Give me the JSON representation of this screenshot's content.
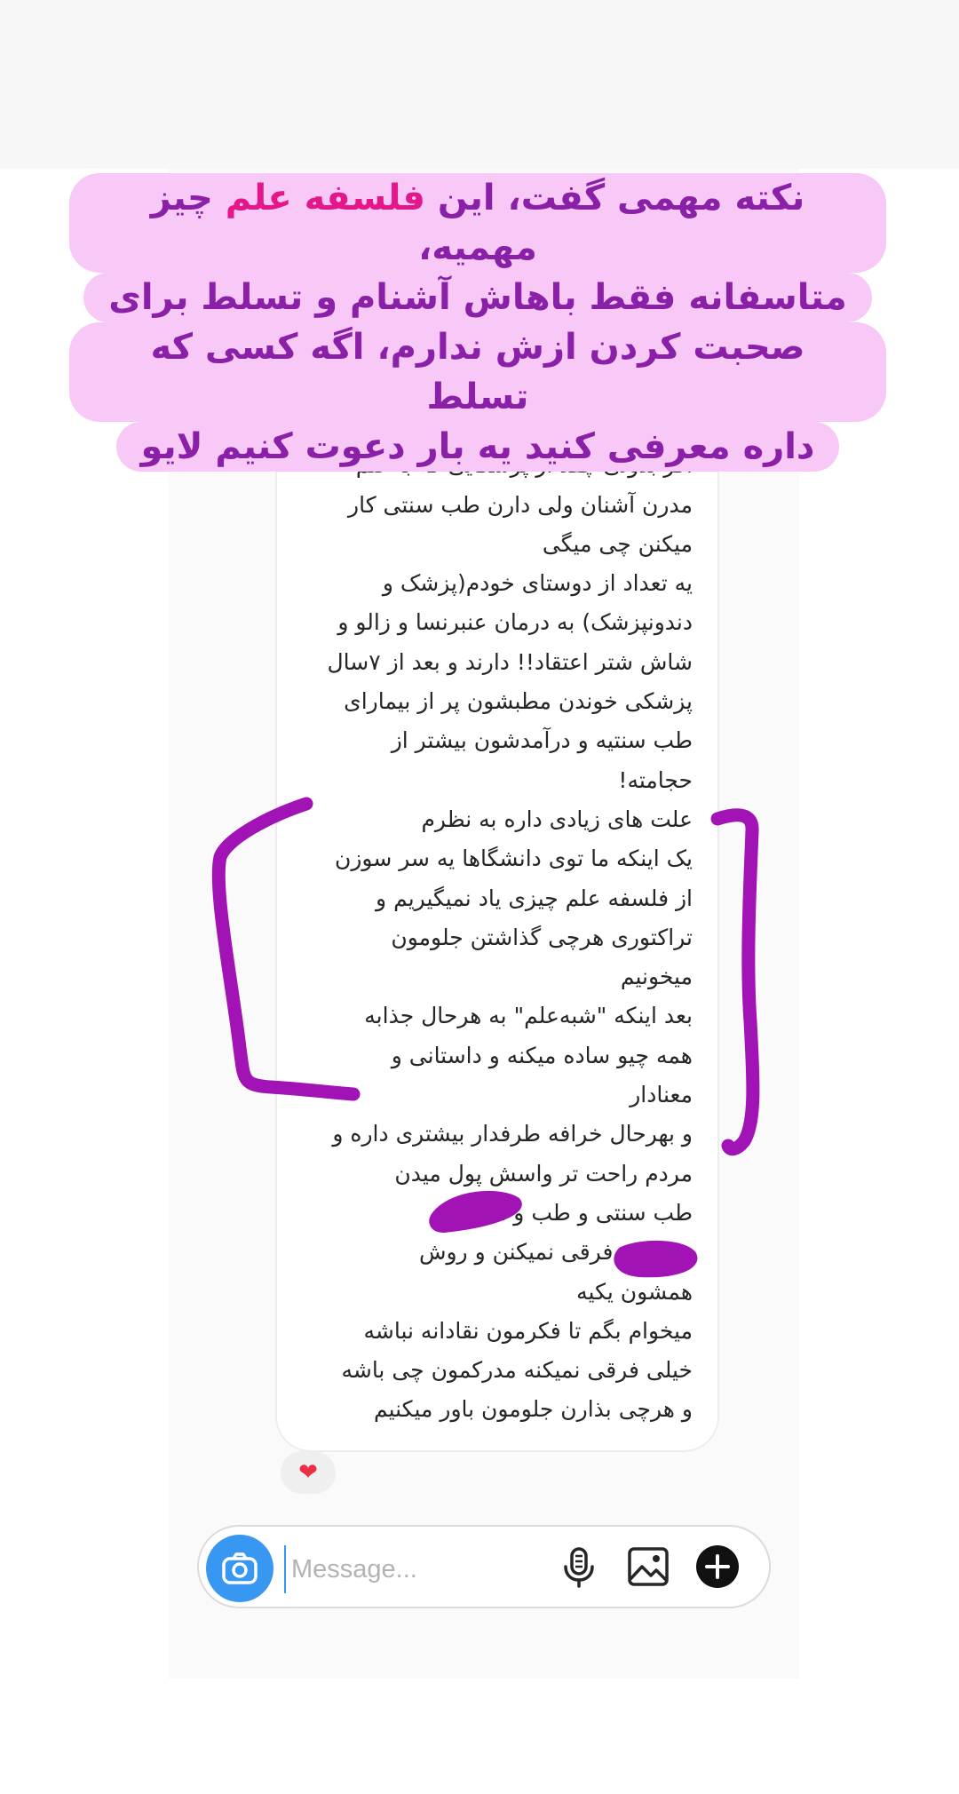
{
  "caption": {
    "lines": [
      [
        {
          "text": "نکته مهمی گفت، این ",
          "hl": false
        },
        {
          "text": "فلسفه علم",
          "hl": true
        },
        {
          "text": " چیز مهمیه،",
          "hl": false
        }
      ],
      [
        {
          "text": "متاسفانه فقط باهاش آشنام و تسلط برای",
          "hl": false
        }
      ],
      [
        {
          "text": "صحبت کردن ازش ندارم، اگه کسی که تسلط",
          "hl": false
        }
      ],
      [
        {
          "text": "داره معرفی کنید یه بار دعوت کنیم لایو",
          "hl": false
        }
      ]
    ]
  },
  "message": {
    "text": "اوضاع از اینم داغون تره\nاگر بدونی چقد از پزشکایی که با علم\nمدرن آشنان ولی دارن طب سنتی کار\nمیکنن چی میگی\nیه تعداد از دوستای خودم(پزشک و\nدندونپزشک) به درمان عنبرنسا و زالو و\nشاش شتر اعتقاد!! دارند و بعد از ۷سال\nپزشکی خوندن مطبشون پر از بیمارای\nطب سنتیه و درآمدشون بیشتر از\nحجامته!\nعلت های زیادی داره به نظرم\nیک اینکه ما توی دانشگاها یه سر سوزن\nاز فلسفه علم چیزی یاد نمیگیریم و\nتراکتوری هرچی گذاشتن جلومون\nمیخونیم\nبعد اینکه \"شبه‌علم\" به هرحال جذابه\nهمه چیو ساده میکنه و داستانی و\nمعنادار\nو بهرحال خرافه طرفدار بیشتری داره و\nمردم راحت تر واسش پول میدن\nطب سنتی و طب         و اقتصاد\n        و ... هم فرقی نمیکنن و روش\nهمشون یکیه\nمیخوام بگم تا فکرمون نقادانه نباشه\nخیلی فرقی نمیکنه مدرکمون چی باشه\nو هرچی بذارن جلومون باور میکنیم"
  },
  "reaction": {
    "emoji": "❤"
  },
  "composer": {
    "placeholder": "Message..."
  },
  "colors": {
    "caption_text": "#8a1fa8",
    "caption_highlight": "#e3178a",
    "caption_bg": "#f8c8f6",
    "annotation": "#a213b5",
    "camera_button": "#3897f0"
  },
  "icons": {
    "camera": "camera-icon",
    "mic": "microphone-icon",
    "gallery": "gallery-icon",
    "plus": "plus-circle-icon"
  }
}
